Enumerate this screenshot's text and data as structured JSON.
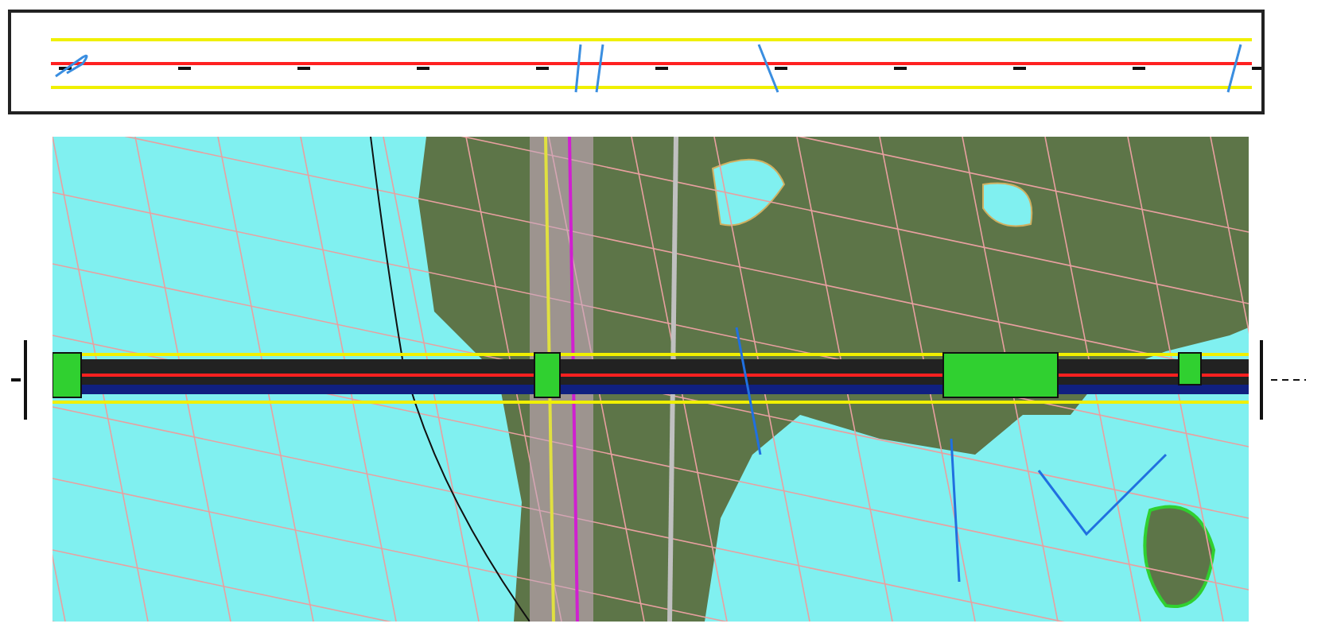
{
  "views": [
    {
      "kind": "profile"
    },
    {
      "kind": "plan"
    }
  ]
}
